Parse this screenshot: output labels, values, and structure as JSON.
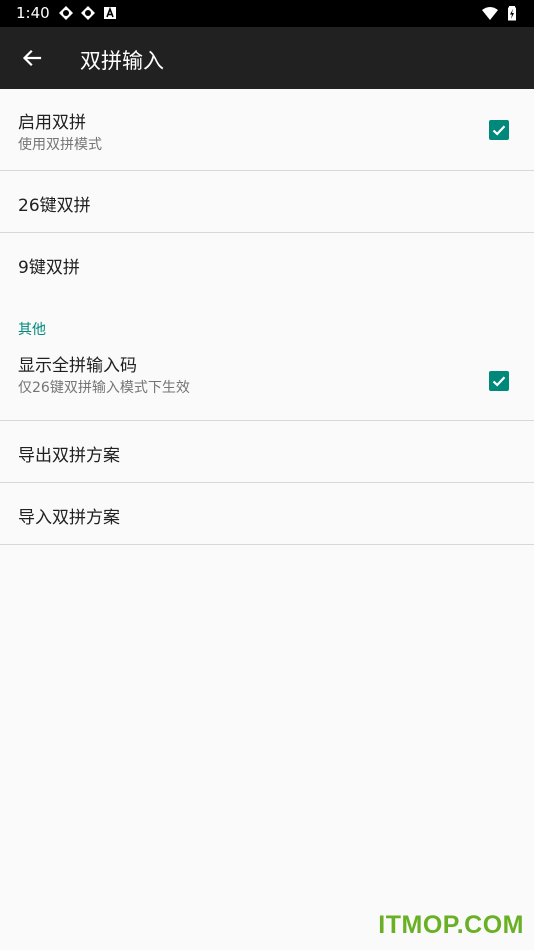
{
  "status_bar": {
    "time": "1:40",
    "icons": [
      "settings-notification-icon",
      "settings-notification-icon",
      "a-notification-icon",
      "wifi-icon",
      "battery-charging-icon"
    ]
  },
  "toolbar": {
    "title": "双拼输入",
    "back_icon": "arrow-back-icon"
  },
  "preferences": {
    "enable": {
      "title": "启用双拼",
      "summary": "使用双拼模式",
      "checked": true
    },
    "scheme26": {
      "title": "26键双拼"
    },
    "scheme9": {
      "title": "9键双拼"
    },
    "other_header": "其他",
    "show_full": {
      "title": "显示全拼输入码",
      "summary": "仅26键双拼输入模式下生效",
      "checked": true
    },
    "export": {
      "title": "导出双拼方案"
    },
    "import": {
      "title": "导入双拼方案"
    }
  },
  "accent_color": "#00897b",
  "watermark": "ITMOP.COM"
}
